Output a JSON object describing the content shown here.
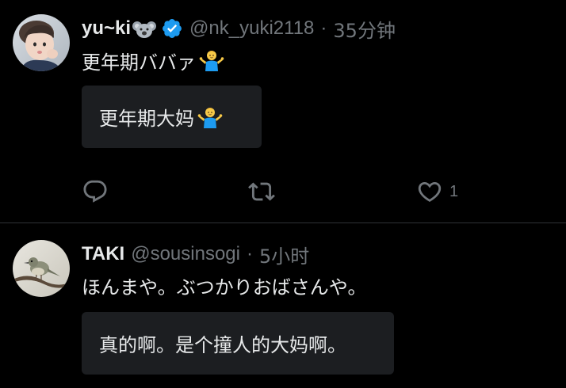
{
  "tweets": [
    {
      "display_name": "yu~ki",
      "name_emoji": "koala-emoji",
      "verified": true,
      "handle": "@nk_yuki2118",
      "separator": "·",
      "time": "35分钟",
      "text": "更年期ババァ",
      "text_emoji": "shrug-emoji",
      "translation": "更年期大妈",
      "translation_emoji": "shrug-emoji",
      "actions": {
        "reply_icon": "reply-icon",
        "retweet_icon": "retweet-icon",
        "like_icon": "heart-icon",
        "like_count": "1"
      }
    },
    {
      "display_name": "TAKI",
      "handle": "@sousinsogi",
      "separator": "·",
      "time": "5小时",
      "text": "ほんまや。ぶつかりおばさんや。",
      "translation": "真的啊。是个撞人的大妈啊。"
    }
  ],
  "colors": {
    "background": "#000000",
    "primary_text": "#e7e9ea",
    "secondary_text": "#71767b",
    "verified_blue": "#1d9bf0",
    "divider": "#2f3336",
    "translation_bg": "#1c1e21"
  }
}
